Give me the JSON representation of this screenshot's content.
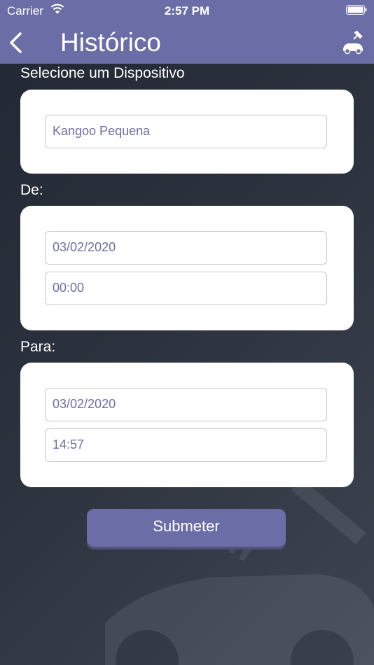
{
  "status_bar": {
    "carrier": "Carrier",
    "time": "2:57 PM"
  },
  "header": {
    "title": "Histórico",
    "back_icon": "chevron-left",
    "action_icon": "car-satellite"
  },
  "device_section": {
    "label": "Selecione um Dispositivo",
    "device_value": "Kangoo Pequena"
  },
  "from_section": {
    "label": "De:",
    "date": "03/02/2020",
    "time": "00:00"
  },
  "to_section": {
    "label": "Para:",
    "date": "03/02/2020",
    "time": "14:57"
  },
  "submit_label": "Submeter",
  "colors": {
    "accent": "#6b6ea6",
    "field_text": "#6e6fa3",
    "background": "#2b323d"
  }
}
